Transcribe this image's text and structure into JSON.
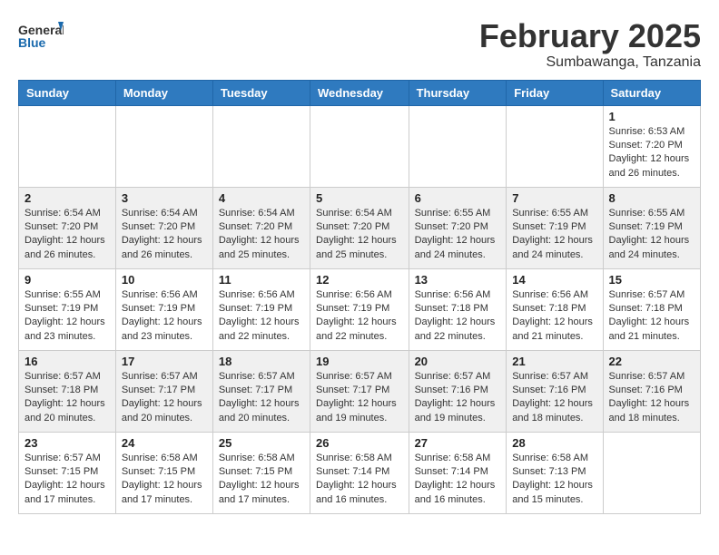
{
  "logo": {
    "general": "General",
    "blue": "Blue"
  },
  "title": {
    "month": "February 2025",
    "location": "Sumbawanga, Tanzania"
  },
  "days": [
    "Sunday",
    "Monday",
    "Tuesday",
    "Wednesday",
    "Thursday",
    "Friday",
    "Saturday"
  ],
  "weeks": [
    [
      {
        "day": "",
        "content": ""
      },
      {
        "day": "",
        "content": ""
      },
      {
        "day": "",
        "content": ""
      },
      {
        "day": "",
        "content": ""
      },
      {
        "day": "",
        "content": ""
      },
      {
        "day": "",
        "content": ""
      },
      {
        "day": "1",
        "content": "Sunrise: 6:53 AM\nSunset: 7:20 PM\nDaylight: 12 hours\nand 26 minutes."
      }
    ],
    [
      {
        "day": "2",
        "content": "Sunrise: 6:54 AM\nSunset: 7:20 PM\nDaylight: 12 hours\nand 26 minutes."
      },
      {
        "day": "3",
        "content": "Sunrise: 6:54 AM\nSunset: 7:20 PM\nDaylight: 12 hours\nand 26 minutes."
      },
      {
        "day": "4",
        "content": "Sunrise: 6:54 AM\nSunset: 7:20 PM\nDaylight: 12 hours\nand 25 minutes."
      },
      {
        "day": "5",
        "content": "Sunrise: 6:54 AM\nSunset: 7:20 PM\nDaylight: 12 hours\nand 25 minutes."
      },
      {
        "day": "6",
        "content": "Sunrise: 6:55 AM\nSunset: 7:20 PM\nDaylight: 12 hours\nand 24 minutes."
      },
      {
        "day": "7",
        "content": "Sunrise: 6:55 AM\nSunset: 7:19 PM\nDaylight: 12 hours\nand 24 minutes."
      },
      {
        "day": "8",
        "content": "Sunrise: 6:55 AM\nSunset: 7:19 PM\nDaylight: 12 hours\nand 24 minutes."
      }
    ],
    [
      {
        "day": "9",
        "content": "Sunrise: 6:55 AM\nSunset: 7:19 PM\nDaylight: 12 hours\nand 23 minutes."
      },
      {
        "day": "10",
        "content": "Sunrise: 6:56 AM\nSunset: 7:19 PM\nDaylight: 12 hours\nand 23 minutes."
      },
      {
        "day": "11",
        "content": "Sunrise: 6:56 AM\nSunset: 7:19 PM\nDaylight: 12 hours\nand 22 minutes."
      },
      {
        "day": "12",
        "content": "Sunrise: 6:56 AM\nSunset: 7:19 PM\nDaylight: 12 hours\nand 22 minutes."
      },
      {
        "day": "13",
        "content": "Sunrise: 6:56 AM\nSunset: 7:18 PM\nDaylight: 12 hours\nand 22 minutes."
      },
      {
        "day": "14",
        "content": "Sunrise: 6:56 AM\nSunset: 7:18 PM\nDaylight: 12 hours\nand 21 minutes."
      },
      {
        "day": "15",
        "content": "Sunrise: 6:57 AM\nSunset: 7:18 PM\nDaylight: 12 hours\nand 21 minutes."
      }
    ],
    [
      {
        "day": "16",
        "content": "Sunrise: 6:57 AM\nSunset: 7:18 PM\nDaylight: 12 hours\nand 20 minutes."
      },
      {
        "day": "17",
        "content": "Sunrise: 6:57 AM\nSunset: 7:17 PM\nDaylight: 12 hours\nand 20 minutes."
      },
      {
        "day": "18",
        "content": "Sunrise: 6:57 AM\nSunset: 7:17 PM\nDaylight: 12 hours\nand 20 minutes."
      },
      {
        "day": "19",
        "content": "Sunrise: 6:57 AM\nSunset: 7:17 PM\nDaylight: 12 hours\nand 19 minutes."
      },
      {
        "day": "20",
        "content": "Sunrise: 6:57 AM\nSunset: 7:16 PM\nDaylight: 12 hours\nand 19 minutes."
      },
      {
        "day": "21",
        "content": "Sunrise: 6:57 AM\nSunset: 7:16 PM\nDaylight: 12 hours\nand 18 minutes."
      },
      {
        "day": "22",
        "content": "Sunrise: 6:57 AM\nSunset: 7:16 PM\nDaylight: 12 hours\nand 18 minutes."
      }
    ],
    [
      {
        "day": "23",
        "content": "Sunrise: 6:57 AM\nSunset: 7:15 PM\nDaylight: 12 hours\nand 17 minutes."
      },
      {
        "day": "24",
        "content": "Sunrise: 6:58 AM\nSunset: 7:15 PM\nDaylight: 12 hours\nand 17 minutes."
      },
      {
        "day": "25",
        "content": "Sunrise: 6:58 AM\nSunset: 7:15 PM\nDaylight: 12 hours\nand 17 minutes."
      },
      {
        "day": "26",
        "content": "Sunrise: 6:58 AM\nSunset: 7:14 PM\nDaylight: 12 hours\nand 16 minutes."
      },
      {
        "day": "27",
        "content": "Sunrise: 6:58 AM\nSunset: 7:14 PM\nDaylight: 12 hours\nand 16 minutes."
      },
      {
        "day": "28",
        "content": "Sunrise: 6:58 AM\nSunset: 7:13 PM\nDaylight: 12 hours\nand 15 minutes."
      },
      {
        "day": "",
        "content": ""
      }
    ]
  ]
}
